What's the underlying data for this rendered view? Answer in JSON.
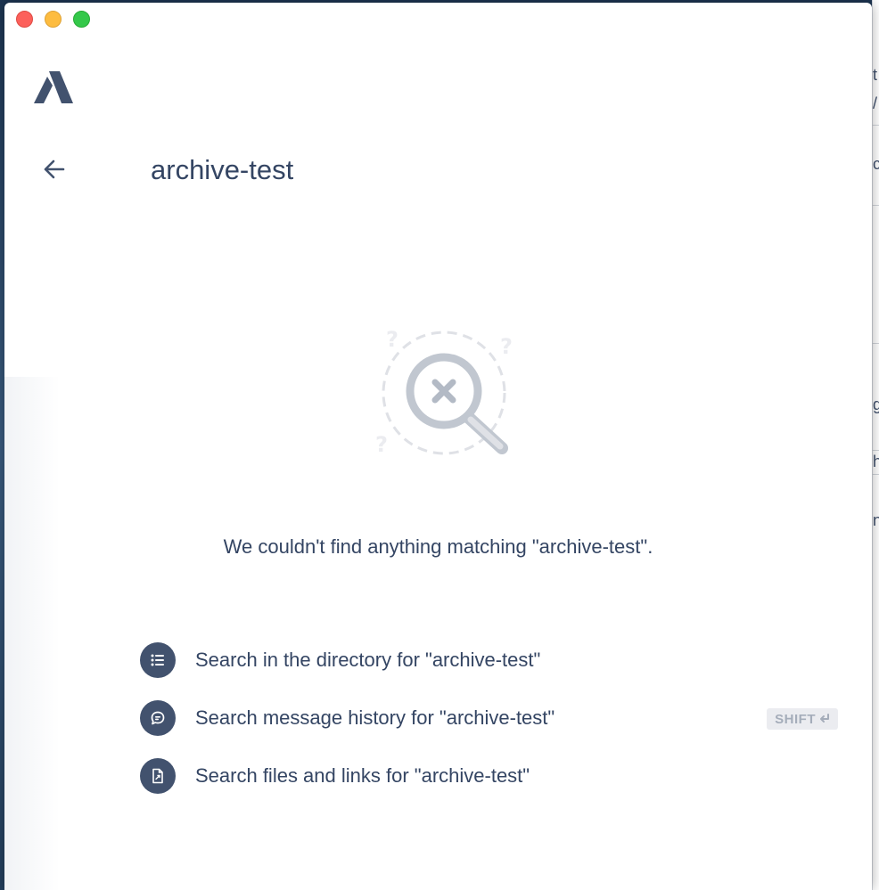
{
  "window": {
    "traffic_lights": [
      "close",
      "minimize",
      "maximize"
    ]
  },
  "app": {
    "logo_icon": "atlassian-stride-logo",
    "accent_color": "#42526e",
    "text_color": "#344563"
  },
  "header": {
    "back_icon": "arrow-left-icon",
    "search_query": "archive-test"
  },
  "empty_state": {
    "illustration_icon": "magnifier-x-icon",
    "message": "We couldn't find anything matching \"archive-test\"."
  },
  "options": [
    {
      "icon": "list-icon",
      "label": "Search in the directory for \"archive-test\"",
      "shortcut": ""
    },
    {
      "icon": "chat-bubble-icon",
      "label": "Search message history for \"archive-test\"",
      "shortcut": "SHIFT"
    },
    {
      "icon": "file-icon",
      "label": "Search files and links for \"archive-test\"",
      "shortcut": ""
    }
  ],
  "background_window": {
    "glyphs": [
      "t",
      "/",
      "c",
      "g",
      "h",
      "n"
    ]
  }
}
